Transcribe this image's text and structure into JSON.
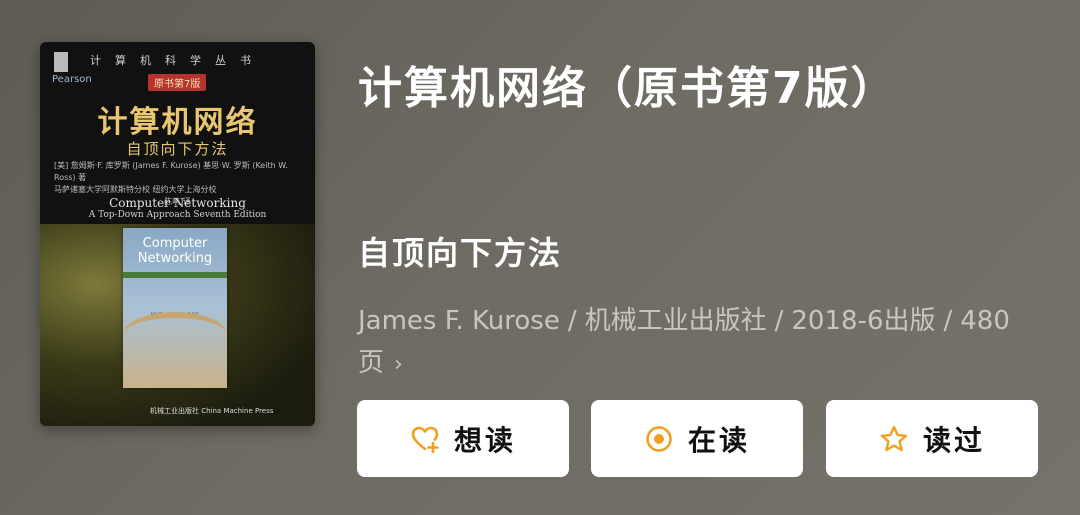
{
  "book": {
    "title": "计算机网络（原书第7版）",
    "subtitle": "自顶向下方法",
    "author": "James F. Kurose",
    "publisher": "机械工业出版社",
    "pub_date": "2018-6出版",
    "pages": "480页"
  },
  "cover": {
    "series": "计算机科学丛书",
    "badge": "原书第7版",
    "brand": "Pearson",
    "cn_title": "计算机网络",
    "cn_subtitle": "自顶向下方法",
    "authors_line1": "[美] 詹姆斯·F. 库罗斯 (James F. Kurose)  基思·W. 罗斯 (Keith W. Ross) 著",
    "authors_line2": "马萨诸塞大学阿默斯特分校   纽约大学上海分校",
    "translator": "陈鸣 译",
    "en_title": "Computer Networking",
    "en_subtitle": "A Top-Down Approach  Seventh Edition",
    "inner_title": "Computer Networking",
    "inner_authors": "KUROSE • ROSS",
    "publisher": "机械工业出版社 China Machine Press"
  },
  "actions": {
    "want_label": "想读",
    "reading_label": "在读",
    "read_label": "读过"
  },
  "colors": {
    "accent": "#f0a020",
    "background": "#6a675f"
  }
}
